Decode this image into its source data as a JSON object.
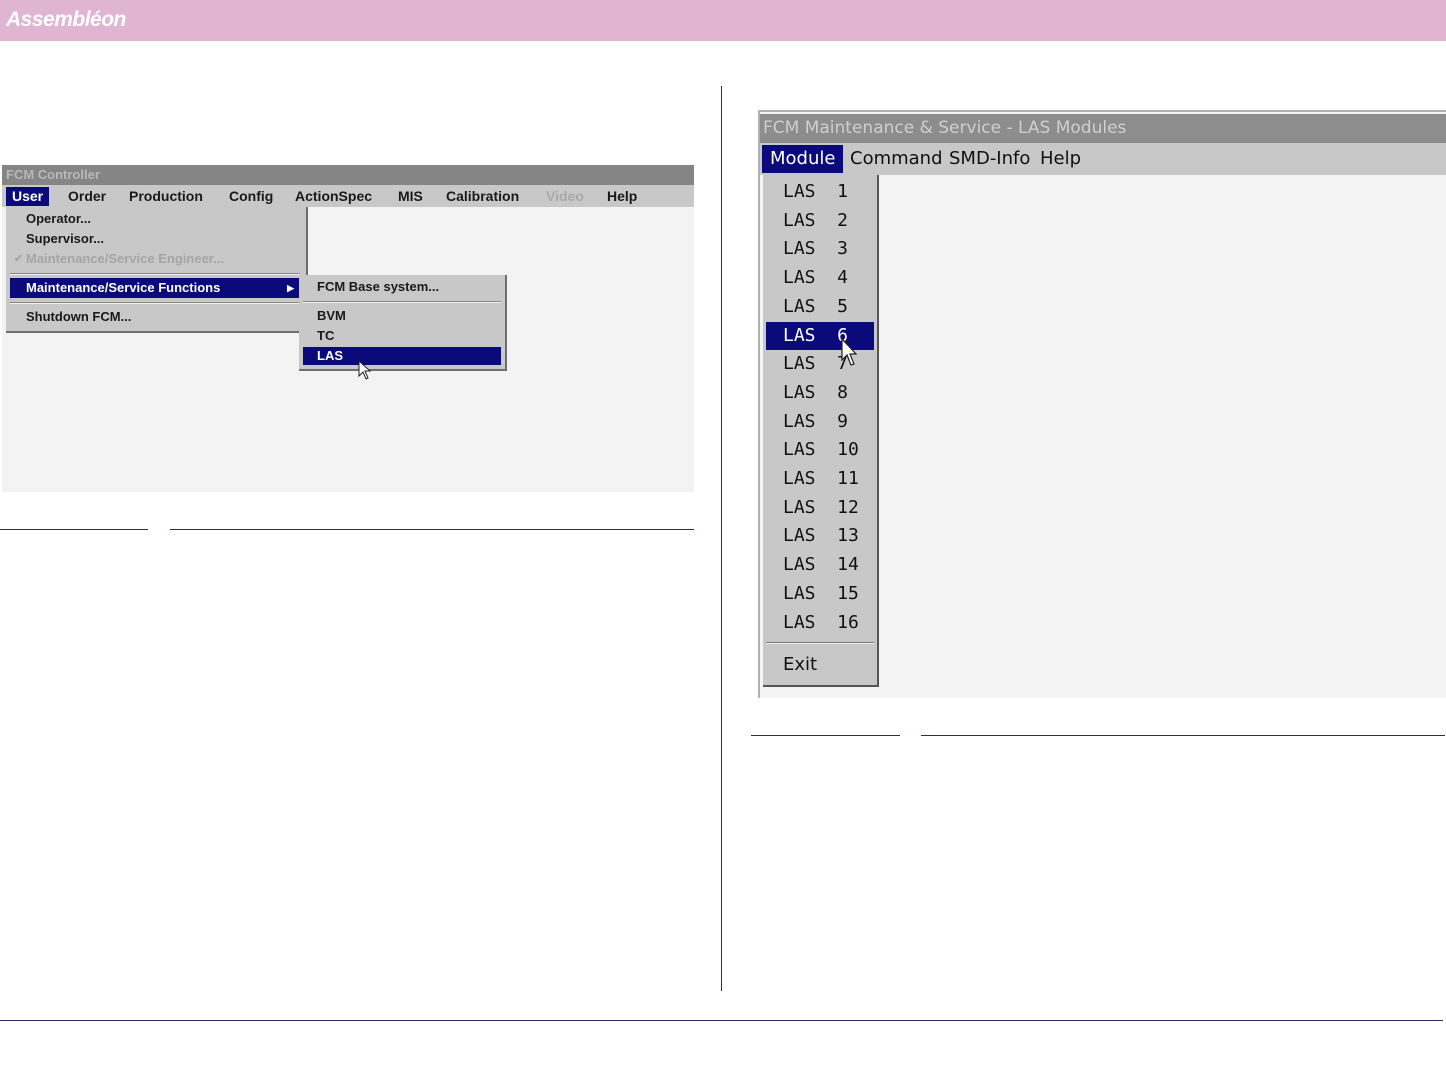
{
  "header": {
    "logo": "Assembléon"
  },
  "left_window": {
    "title": "FCM Controller",
    "menubar": [
      "User",
      "Order",
      "Production",
      "Config",
      "ActionSpec",
      "MIS",
      "Calibration",
      "Video",
      "Help"
    ],
    "active_menu": "User",
    "disabled_menu": "Video",
    "user_menu": {
      "items": [
        "Operator...",
        "Supervisor...",
        "Maintenance/Service Engineer...",
        "Maintenance/Service Functions",
        "Shutdown FCM..."
      ],
      "checked_item": "Maintenance/Service Engineer...",
      "highlighted_item": "Maintenance/Service Functions"
    },
    "submenu": {
      "items": [
        "FCM Base system...",
        "BVM",
        "TC",
        "LAS"
      ],
      "highlighted_item": "LAS"
    }
  },
  "right_window": {
    "title": "FCM Maintenance & Service - LAS Modules",
    "menubar": [
      "Module",
      "Command",
      "SMD-Info",
      "Help"
    ],
    "active_menu": "Module",
    "module_menu": {
      "items": [
        "LAS  1",
        "LAS  2",
        "LAS  3",
        "LAS  4",
        "LAS  5",
        "LAS  6",
        "LAS  7",
        "LAS  8",
        "LAS  9",
        "LAS  10",
        "LAS  11",
        "LAS  12",
        "LAS  13",
        "LAS  14",
        "LAS  15",
        "LAS  16"
      ],
      "highlighted_item": "LAS  6",
      "exit_label": "Exit"
    }
  },
  "colors": {
    "banner": "#dfb5d2",
    "selection": "#0a0a7a",
    "menu_bg": "#c8c8c8",
    "rule": "#2a2a6a"
  }
}
